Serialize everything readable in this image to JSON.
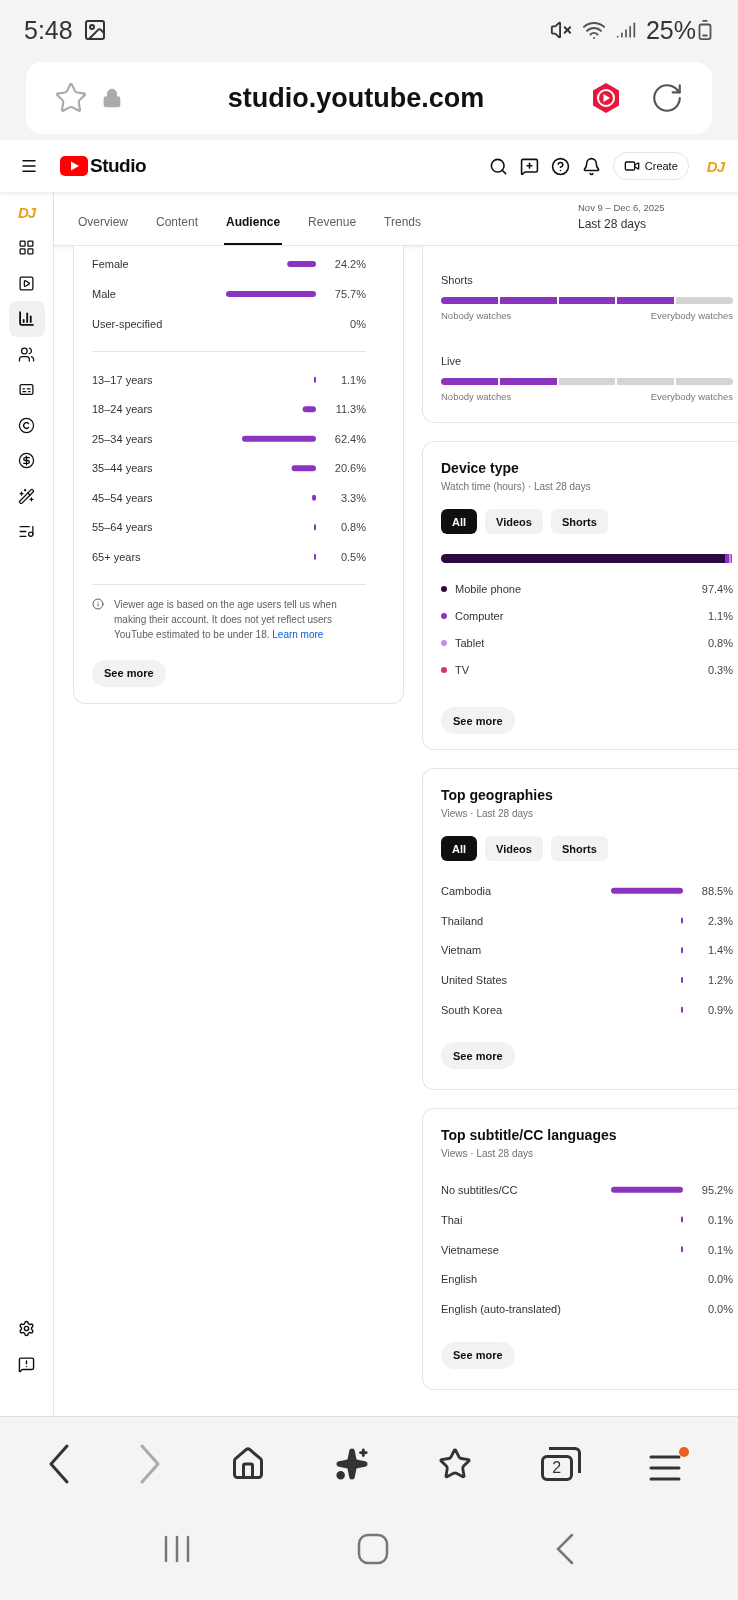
{
  "status_bar": {
    "time": "5:48",
    "battery": "25%"
  },
  "browser": {
    "url": "studio.youtube.com"
  },
  "header": {
    "product": "Studio",
    "create_label": "Create",
    "avatar_text": "DJ"
  },
  "sidebar": {
    "avatar_text": "DJ",
    "items": [
      {
        "selected": false
      },
      {
        "selected": false
      },
      {
        "selected": true
      },
      {
        "selected": false
      },
      {
        "selected": false
      },
      {
        "selected": false
      },
      {
        "selected": false
      },
      {
        "selected": false
      },
      {
        "selected": false
      }
    ]
  },
  "tabs": [
    {
      "label": "Overview",
      "selected": false
    },
    {
      "label": "Content",
      "selected": false
    },
    {
      "label": "Audience",
      "selected": true
    },
    {
      "label": "Revenue",
      "selected": false
    },
    {
      "label": "Trends",
      "selected": false
    }
  ],
  "date_range": {
    "range": "Nov 9 – Dec 6, 2025",
    "preset": "Last 28 days"
  },
  "gender_age_card": {
    "gender": {
      "chart_data": {
        "type": "bar",
        "orientation": "horizontal",
        "categories": [
          "Female",
          "Male",
          "User-specified"
        ],
        "values": [
          24.2,
          75.7,
          0
        ],
        "value_labels": [
          "24.2%",
          "75.7%",
          "0%"
        ]
      }
    },
    "age": {
      "chart_data": {
        "type": "bar",
        "orientation": "horizontal",
        "categories": [
          "13–17 years",
          "18–24 years",
          "25–34 years",
          "35–44 years",
          "45–54 years",
          "55–64 years",
          "65+ years"
        ],
        "values": [
          1.1,
          11.3,
          62.4,
          20.6,
          3.3,
          0.8,
          0.5
        ],
        "value_labels": [
          "1.1%",
          "11.3%",
          "62.4%",
          "20.6%",
          "3.3%",
          "0.8%",
          "0.5%"
        ]
      }
    },
    "note": "Viewer age is based on the age users tell us when making their account. It does not yet reflect users YouTube estimated to be under 18.",
    "note_link": "Learn more",
    "button": "See more"
  },
  "format_card": {
    "rows": [
      {
        "label": "Shorts",
        "level": 0.8,
        "min_caption": "Nobody watches",
        "max_caption": "Everybody watches"
      },
      {
        "label": "Live",
        "level": 0.4,
        "min_caption": "Nobody watches",
        "max_caption": "Everybody watches"
      }
    ]
  },
  "device_card": {
    "title": "Device type",
    "subtitle": "Watch time (hours) · Last 28 days",
    "filters": [
      {
        "label": "All",
        "selected": true
      },
      {
        "label": "Videos",
        "selected": false
      },
      {
        "label": "Shorts",
        "selected": false
      }
    ],
    "items": [
      {
        "label": "Mobile phone",
        "value": "97.4%",
        "level": 0.974,
        "color": "#2a0a3e"
      },
      {
        "label": "Computer",
        "value": "1.1%",
        "level": 0.011,
        "color": "#8a35c0"
      },
      {
        "label": "Tablet",
        "value": "0.8%",
        "level": 0.008,
        "color": "#c98af0"
      },
      {
        "label": "TV",
        "value": "0.3%",
        "level": 0.003,
        "color": "#d6336c"
      }
    ],
    "button": "See more"
  },
  "geo_card": {
    "title": "Top geographies",
    "subtitle": "Views · Last 28 days",
    "filters": [
      {
        "label": "All",
        "selected": true
      },
      {
        "label": "Videos",
        "selected": false
      },
      {
        "label": "Shorts",
        "selected": false
      }
    ],
    "chart_data": {
      "type": "bar",
      "orientation": "horizontal",
      "categories": [
        "Cambodia",
        "Thailand",
        "Vietnam",
        "United States",
        "South Korea"
      ],
      "values": [
        88.5,
        2.3,
        1.4,
        1.2,
        0.9
      ],
      "value_labels": [
        "88.5%",
        "2.3%",
        "1.4%",
        "1.2%",
        "0.9%"
      ]
    },
    "button": "See more"
  },
  "subtitle_card": {
    "title": "Top subtitle/CC languages",
    "subtitle": "Views · Last 28 days",
    "chart_data": {
      "type": "bar",
      "orientation": "horizontal",
      "categories": [
        "No subtitles/CC",
        "Thai",
        "Vietnamese",
        "English",
        "English (auto-translated)"
      ],
      "values": [
        95.2,
        0.1,
        0.1,
        0,
        0
      ],
      "value_labels": [
        "95.2%",
        "0.1%",
        "0.1%",
        "0.0%",
        "0.0%"
      ]
    },
    "button": "See more"
  },
  "bottom_nav": {
    "forward_disabled": true,
    "tab_count": "2",
    "menu_badge": true
  }
}
